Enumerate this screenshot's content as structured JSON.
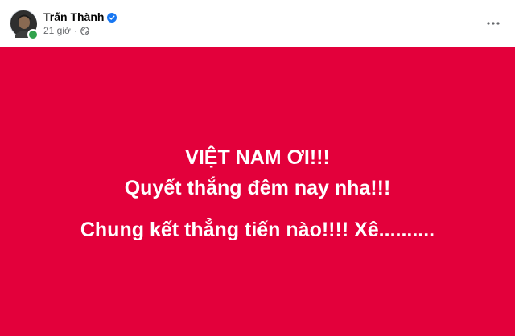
{
  "author": {
    "name": "Trấn Thành",
    "verified": true,
    "online": true,
    "timestamp": "21 giờ",
    "separator": "·",
    "audience_icon": "globe-icon"
  },
  "post": {
    "background_color": "#e3003b",
    "lines": [
      "VIỆT NAM ƠI!!!",
      "Quyết thắng đêm nay nha!!!",
      "Chung kết thẳng tiến nào!!!! Xê.........."
    ]
  },
  "header": {
    "more_icon": "more-options-icon"
  },
  "colors": {
    "verified": "#1877f2",
    "online": "#31a24c",
    "meta_text": "#65676b"
  }
}
